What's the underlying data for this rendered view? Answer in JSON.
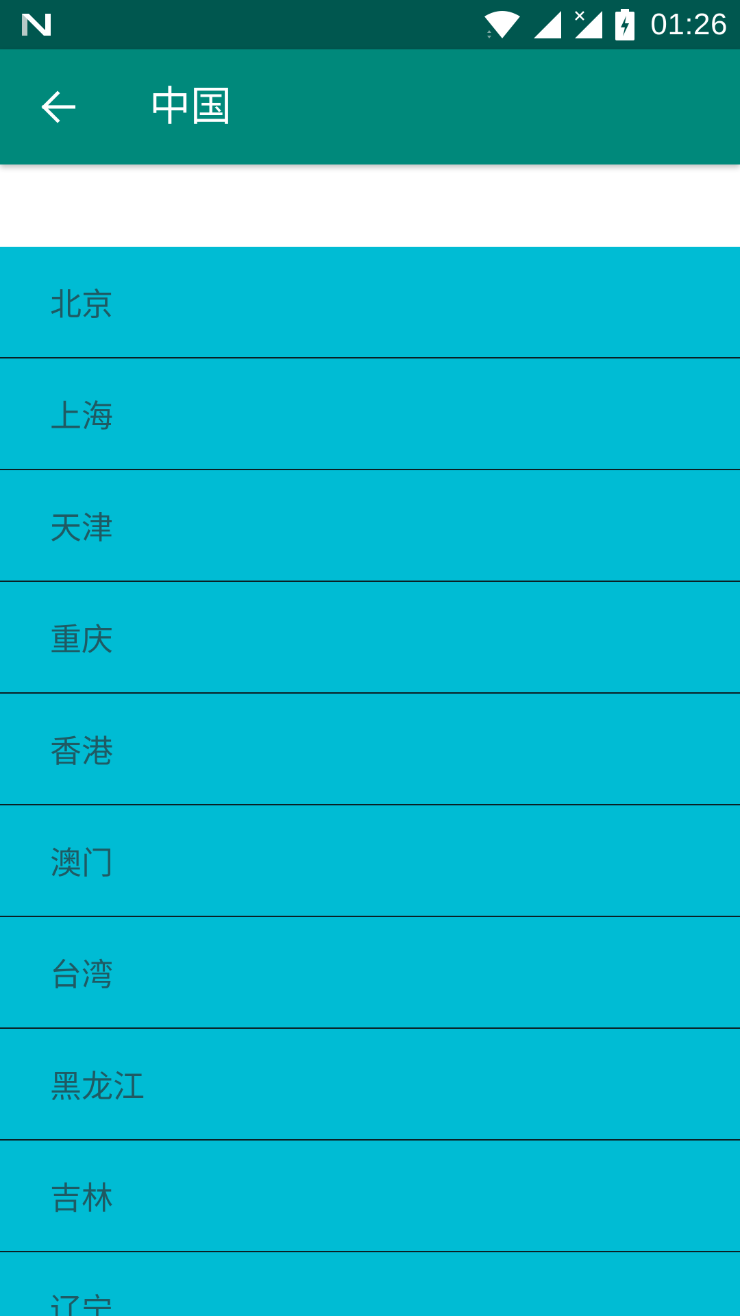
{
  "status_bar": {
    "time": "01:26",
    "icons": [
      "n-logo-icon",
      "wifi-icon",
      "cell-signal-icon",
      "cell-signal-no-service-icon",
      "battery-charging-icon"
    ]
  },
  "app_bar": {
    "back_icon": "arrow-back-icon",
    "title": "中国"
  },
  "colors": {
    "status_bar": "#00574f",
    "app_bar": "#00897b",
    "list_background": "#00bcd4",
    "list_text": "#1f5a63",
    "divider": "#0b1f24"
  },
  "list": {
    "items": [
      {
        "label": "北京"
      },
      {
        "label": "上海"
      },
      {
        "label": "天津"
      },
      {
        "label": "重庆"
      },
      {
        "label": "香港"
      },
      {
        "label": "澳门"
      },
      {
        "label": "台湾"
      },
      {
        "label": "黑龙江"
      },
      {
        "label": "吉林"
      },
      {
        "label": "辽宁"
      }
    ]
  }
}
